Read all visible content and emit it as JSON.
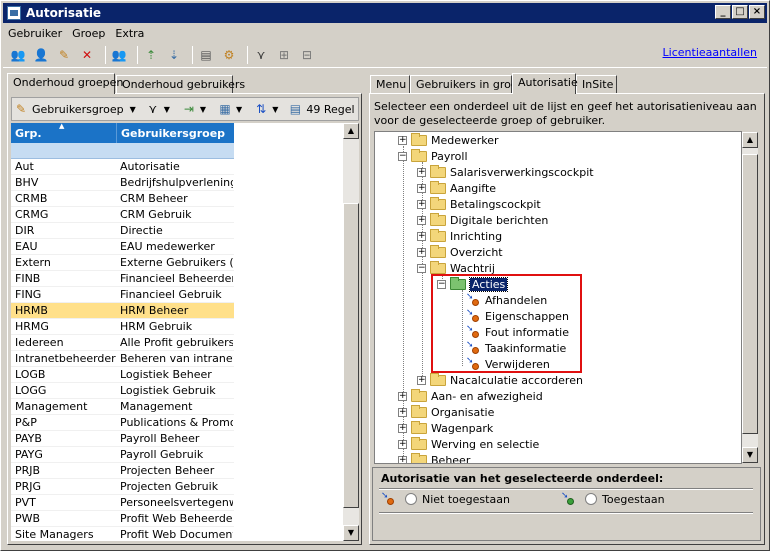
{
  "window": {
    "title": "Autorisatie"
  },
  "menu": [
    "Gebruiker",
    "Groep",
    "Extra"
  ],
  "license_link": "Licentieaantallen",
  "left_tabs": [
    "Onderhoud groepen",
    "Onderhoud gebruikers"
  ],
  "left_toolbar": {
    "group_label": "Gebruikersgroep",
    "rule_count": "49 Regel"
  },
  "table": {
    "columns": [
      "Grp.",
      "Gebruikersgroep"
    ],
    "rows": [
      [
        "Aut",
        "Autorisatie"
      ],
      [
        "BHV",
        "Bedrijfshulpverlening"
      ],
      [
        "CRMB",
        "CRM Beheer"
      ],
      [
        "CRMG",
        "CRM Gebruik"
      ],
      [
        "DIR",
        "Directie"
      ],
      [
        "EAU",
        "EAU medewerker"
      ],
      [
        "Extern",
        "Externe Gebruikers (Cor"
      ],
      [
        "FINB",
        "Financieel Beheerder"
      ],
      [
        "FING",
        "Financieel Gebruik"
      ],
      [
        "HRMB",
        "HRM Beheer"
      ],
      [
        "HRMG",
        "HRM Gebruik"
      ],
      [
        "Iedereen",
        "Alle Profit gebruikers"
      ],
      [
        "Intranetbeheerder",
        "Beheren van intranet"
      ],
      [
        "LOGB",
        "Logistiek Beheer"
      ],
      [
        "LOGG",
        "Logistiek Gebruik"
      ],
      [
        "Management",
        "Management"
      ],
      [
        "P&P",
        "Publications & Promotior"
      ],
      [
        "PAYB",
        "Payroll Beheer"
      ],
      [
        "PAYG",
        "Payroll Gebruik"
      ],
      [
        "PRJB",
        "Projecten Beheer"
      ],
      [
        "PRJG",
        "Projecten Gebruik"
      ],
      [
        "PVT",
        "Personeelsvertegenwoo"
      ],
      [
        "PWB",
        "Profit Web Beheerder"
      ],
      [
        "Site Managers",
        "Profit Web Documenten"
      ]
    ]
  },
  "right_tabs": [
    "Menu",
    "Gebruikers in groep",
    "Autorisatie",
    "InSite"
  ],
  "instruction": "Selecteer een onderdeel uit de lijst en geef het autorisatieniveau aan voor de geselecteerde groep of gebruiker.",
  "tree": {
    "medewerker": "Medewerker",
    "payroll": "Payroll",
    "salaris": "Salarisverwerkingscockpit",
    "aangifte": "Aangifte",
    "betaling": "Betalingscockpit",
    "digitale": "Digitale berichten",
    "inrichting": "Inrichting",
    "overzicht": "Overzicht",
    "wachtrij": "Wachtrij",
    "acties": "Acties",
    "afhandelen": "Afhandelen",
    "eigenschappen": "Eigenschappen",
    "fout": "Fout informatie",
    "taak": "Taakinformatie",
    "verwijderen": "Verwijderen",
    "nacalculatie": "Nacalculatie accorderen",
    "aan_afwezig": "Aan- en afwezigheid",
    "organisatie": "Organisatie",
    "wagenpark": "Wagenpark",
    "werving": "Werving en selectie",
    "beheer": "Beheer"
  },
  "auth": {
    "label": "Autorisatie van het geselecteerde onderdeel:",
    "opt1": "Niet toegestaan",
    "opt2": "Toegestaan"
  }
}
